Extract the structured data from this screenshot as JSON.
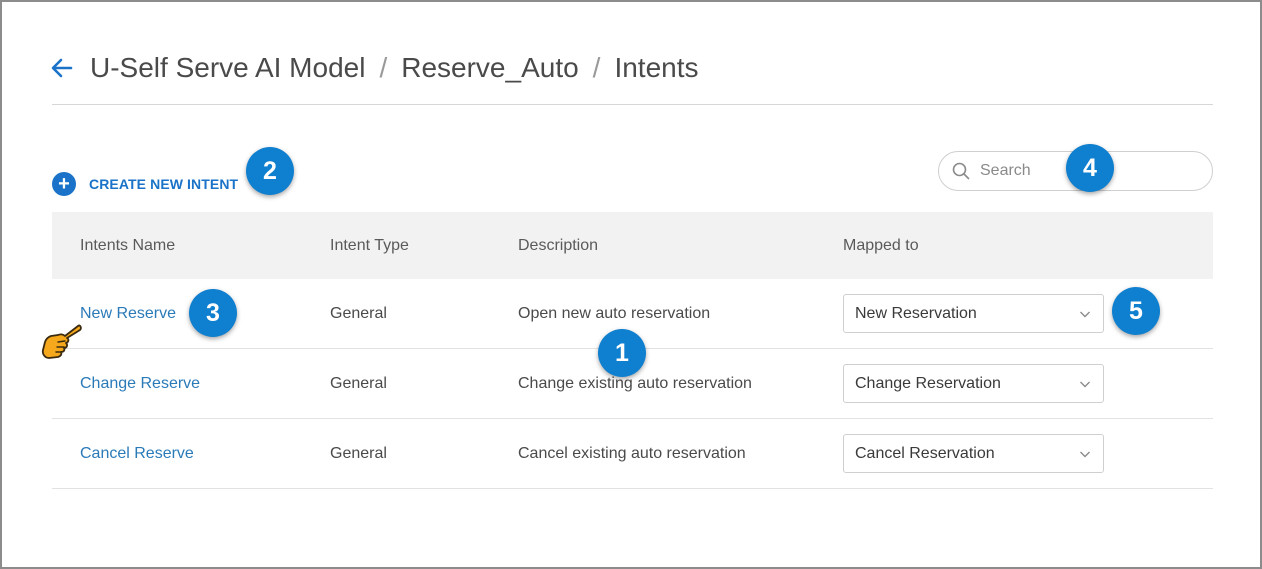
{
  "breadcrumb": {
    "root": "U-Self Serve AI Model",
    "model": "Reserve_Auto",
    "current": "Intents",
    "separator": "/"
  },
  "toolbar": {
    "create_label": "CREATE NEW INTENT"
  },
  "search": {
    "placeholder": "Search"
  },
  "table": {
    "headers": [
      "Intents Name",
      "Intent Type",
      "Description",
      "Mapped to"
    ],
    "rows": [
      {
        "name": "New Reserve",
        "type": "General",
        "description": "Open new auto reservation",
        "mapped_to": "New Reservation"
      },
      {
        "name": "Change Reserve",
        "type": "General",
        "description": "Change existing auto reservation",
        "mapped_to": "Change Reservation"
      },
      {
        "name": "Cancel Reserve",
        "type": "General",
        "description": "Cancel existing auto reservation",
        "mapped_to": "Cancel Reservation"
      }
    ]
  },
  "callouts": [
    "1",
    "2",
    "3",
    "4",
    "5"
  ],
  "icons": {
    "back": "back-arrow-icon",
    "create": "plus-circle-icon",
    "search": "search-icon",
    "dropdown": "chevron-down-icon",
    "pointer": "pointing-hand-icon"
  },
  "colors": {
    "accent": "#1a73c8",
    "link": "#2a7ab8",
    "callout": "#0f7fcf",
    "header_bg": "#f2f2f2"
  }
}
